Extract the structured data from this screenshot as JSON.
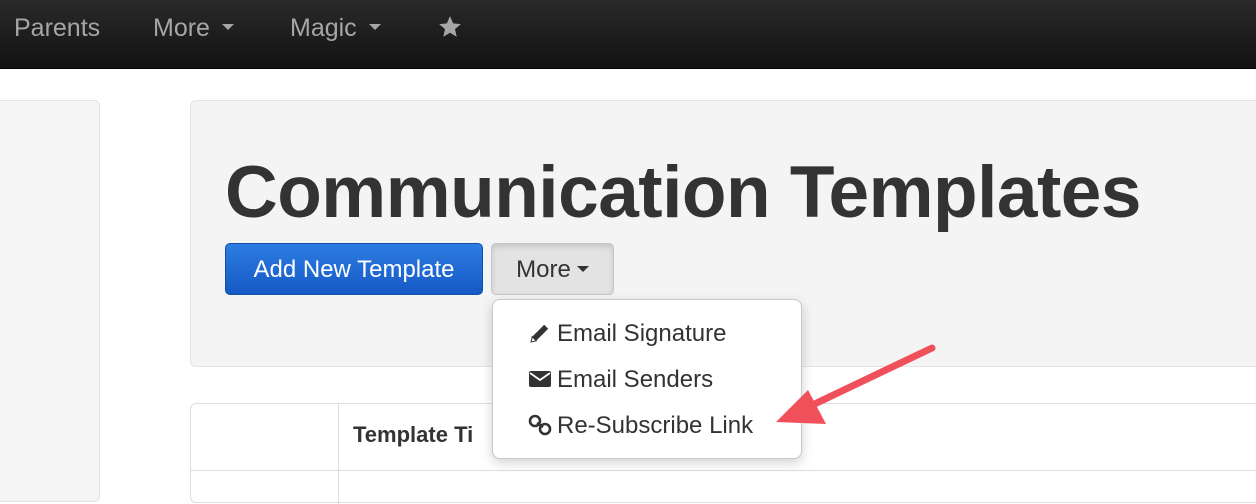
{
  "navbar": {
    "items": [
      {
        "label": "Parents"
      },
      {
        "label": "More"
      },
      {
        "label": "Magic"
      }
    ],
    "star_icon": "star-icon"
  },
  "page": {
    "title": "Communication Templates"
  },
  "actions": {
    "add_template_label": "Add New Template",
    "more_label": "More"
  },
  "dropdown": {
    "items": [
      {
        "label": "Email Signature",
        "icon": "pencil-icon"
      },
      {
        "label": "Email Senders",
        "icon": "envelope-icon"
      },
      {
        "label": "Re-Subscribe Link",
        "icon": "link-icon"
      }
    ]
  },
  "table": {
    "header": "Template Ti"
  },
  "colors": {
    "navbar_bg": "#1a1a1a",
    "primary_button": "#1f66d6",
    "annotation_arrow": "#f0505a"
  }
}
